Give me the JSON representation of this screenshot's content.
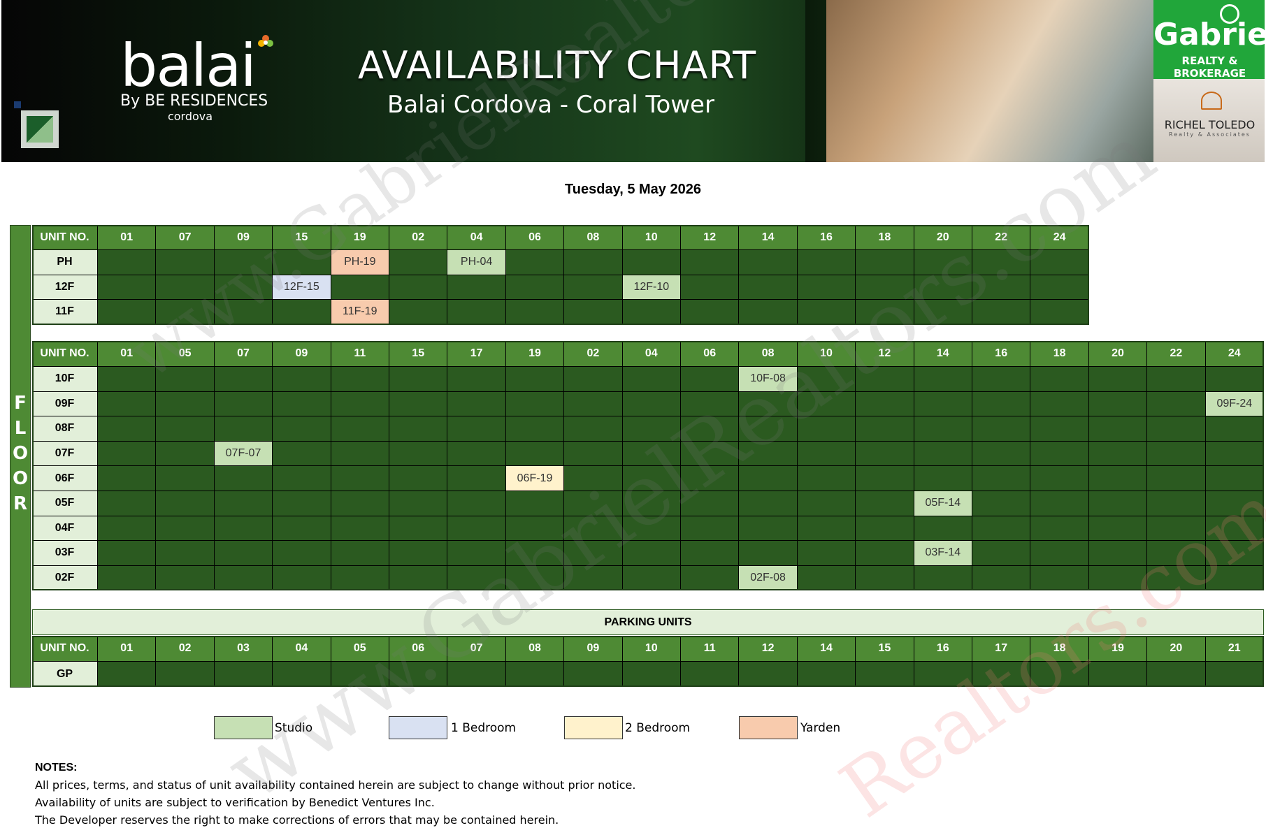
{
  "header": {
    "brand_word": "balai",
    "brand_by": "By BE RESIDENCES",
    "brand_city": "cordova",
    "title": "AVAILABILITY CHART",
    "subtitle": "Balai Cordova - Coral Tower",
    "agency_name": "Gabriel",
    "agency_tag": "REALTY & BROKERAGE",
    "partner_name": "RICHEL TOLEDO",
    "partner_tag": "Realty & Associates"
  },
  "date": "Tuesday, 5 May 2026",
  "floor_letters": [
    "F",
    "L",
    "O",
    "O",
    "R"
  ],
  "upper_block": {
    "header_label": "UNIT NO.",
    "columns": [
      "01",
      "07",
      "09",
      "15",
      "19",
      "02",
      "04",
      "06",
      "08",
      "10",
      "12",
      "14",
      "16",
      "18",
      "20",
      "22",
      "24"
    ],
    "rows": [
      {
        "label": "PH",
        "units": {
          "4": {
            "text": "PH-19",
            "type": "yarden"
          },
          "6": {
            "text": "PH-04",
            "type": "studio"
          }
        }
      },
      {
        "label": "12F",
        "units": {
          "3": {
            "text": "12F-15",
            "type": "onebed"
          },
          "9": {
            "text": "12F-10",
            "type": "studio"
          }
        }
      },
      {
        "label": "11F",
        "units": {
          "4": {
            "text": "11F-19",
            "type": "yarden"
          }
        }
      }
    ]
  },
  "lower_block": {
    "header_label": "UNIT NO.",
    "columns": [
      "01",
      "05",
      "07",
      "09",
      "11",
      "15",
      "17",
      "19",
      "02",
      "04",
      "06",
      "08",
      "10",
      "12",
      "14",
      "16",
      "18",
      "20",
      "22",
      "24"
    ],
    "rows": [
      {
        "label": "10F",
        "units": {
          "11": {
            "text": "10F-08",
            "type": "studio"
          }
        }
      },
      {
        "label": "09F",
        "units": {
          "19": {
            "text": "09F-24",
            "type": "studio"
          }
        }
      },
      {
        "label": "08F",
        "units": {}
      },
      {
        "label": "07F",
        "units": {
          "2": {
            "text": "07F-07",
            "type": "studio"
          }
        }
      },
      {
        "label": "06F",
        "units": {
          "7": {
            "text": "06F-19",
            "type": "twobed"
          }
        }
      },
      {
        "label": "05F",
        "units": {
          "14": {
            "text": "05F-14",
            "type": "studio"
          }
        }
      },
      {
        "label": "04F",
        "units": {}
      },
      {
        "label": "03F",
        "units": {
          "14": {
            "text": "03F-14",
            "type": "studio"
          }
        }
      },
      {
        "label": "02F",
        "units": {
          "11": {
            "text": "02F-08",
            "type": "studio"
          }
        }
      }
    ]
  },
  "parking_block": {
    "title": "PARKING UNITS",
    "header_label": "UNIT NO.",
    "columns": [
      "01",
      "02",
      "03",
      "04",
      "05",
      "06",
      "07",
      "08",
      "09",
      "10",
      "11",
      "12",
      "14",
      "15",
      "16",
      "17",
      "18",
      "19",
      "20",
      "21"
    ],
    "rows": [
      {
        "label": "GP",
        "units": {}
      }
    ]
  },
  "legend": [
    {
      "label": "Studio",
      "type": "studio",
      "color": "#c6e0b4"
    },
    {
      "label": "1 Bedroom",
      "type": "onebed",
      "color": "#d9e1f2"
    },
    {
      "label": "2 Bedroom",
      "type": "twobed",
      "color": "#fff2cc"
    },
    {
      "label": "Yarden",
      "type": "yarden",
      "color": "#f8cbad"
    }
  ],
  "notes": {
    "heading": "NOTES:",
    "lines": [
      "All prices, terms, and status of unit availability contained herein are subject to change without prior notice.",
      "Availability of units are subject to verification by Benedict Ventures Inc.",
      "The Developer reserves the right to make corrections of errors that may be contained herein."
    ]
  },
  "watermark": {
    "text1": "www.GabrielRealtors.com",
    "text2": "www.GabrielRealtors.com",
    "text3": "Realtors.com"
  },
  "colors": {
    "header_green": "#4e8a34",
    "cell_green": "#2b5a20",
    "label_bg": "#e2efd9",
    "agency_green": "#21a63a"
  }
}
